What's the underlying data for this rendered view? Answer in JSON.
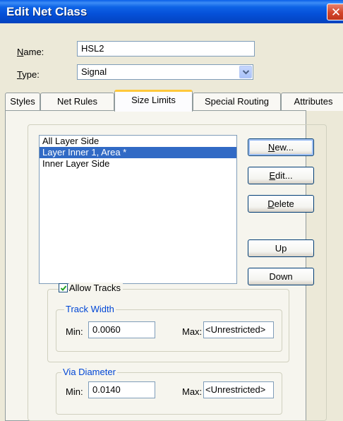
{
  "window": {
    "title": "Edit Net Class",
    "close_glyph": "✕"
  },
  "form": {
    "name_label": "ame:",
    "name_key": "N",
    "name_value": "HSL2",
    "type_label": "ype:",
    "type_key": "T",
    "type_value": "Signal"
  },
  "tabs": [
    {
      "label": "Styles",
      "active": false
    },
    {
      "label": "Net Rules",
      "active": false
    },
    {
      "label": "Size Limits",
      "active": true
    },
    {
      "label": "Special Routing",
      "active": false
    },
    {
      "label": "Attributes",
      "active": false
    }
  ],
  "layers": {
    "items": [
      "All Layer Side",
      "Layer Inner 1, Area *",
      "Inner Layer Side"
    ],
    "selected_index": 1
  },
  "buttons": {
    "new_key": "N",
    "new_rest": "ew...",
    "edit_key": "E",
    "edit_rest": "dit...",
    "delete_key": "D",
    "delete_rest": "elete",
    "up_label": "Up",
    "down_label": "Down"
  },
  "allow_tracks": {
    "label": "Allow Tracks",
    "checked": true
  },
  "track_width": {
    "legend": "Track Width",
    "min_label": "Min:",
    "min_value": "0.0060",
    "max_label": "Max:",
    "max_value": "<Unrestricted>"
  },
  "via_diameter": {
    "legend": "Via Diameter",
    "min_label": "Min:",
    "min_value": "0.0140",
    "max_label": "Max:",
    "max_value": "<Unrestricted>"
  },
  "colors": {
    "title_bar": "#0550D8",
    "selection": "#316AC5",
    "groupbox_text": "#0046D5",
    "active_tab_accent": "#FFC83C"
  }
}
